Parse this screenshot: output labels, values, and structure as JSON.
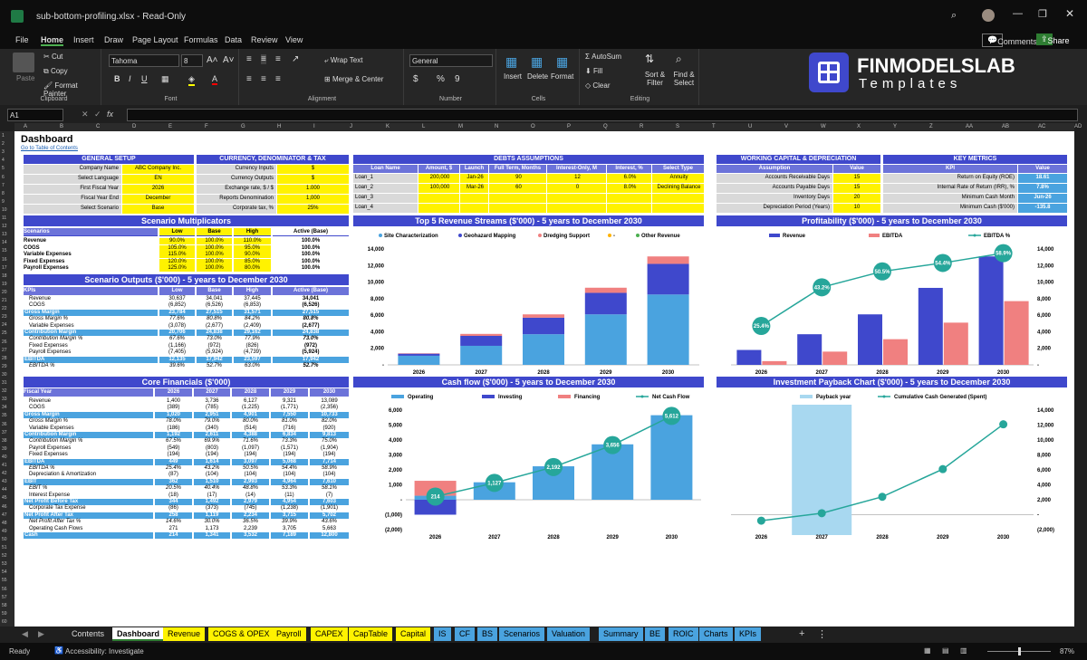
{
  "window": {
    "title": "sub-bottom-profiling.xlsx  -  Read-Only"
  },
  "menu": [
    "File",
    "Home",
    "Insert",
    "Draw",
    "Page Layout",
    "Formulas",
    "Data",
    "Review",
    "View"
  ],
  "ribbon": {
    "paste": "Paste",
    "cut": "Cut",
    "copy": "Copy",
    "format_painter": "Format Painter",
    "clipboard": "Clipboard",
    "font_name": "Tahoma",
    "font_size": "8",
    "font": "Font",
    "wrap": "Wrap Text",
    "merge": "Merge & Center",
    "alignment": "Alignment",
    "number_format": "General",
    "number": "Number",
    "insert": "Insert",
    "delete": "Delete",
    "format": "Format",
    "cells": "Cells",
    "autosum": "AutoSum",
    "fill": "Fill",
    "clear": "Clear",
    "sort": "Sort & Filter",
    "find": "Find & Select",
    "editing": "Editing",
    "comments": "Comments",
    "share": "Share",
    "brand": "FINMODELSLAB",
    "brand_sub": "Templates"
  },
  "formula": {
    "cell": "A1",
    "fx": "fx"
  },
  "columns": [
    "A",
    "B",
    "C",
    "D",
    "E",
    "F",
    "G",
    "H",
    "I",
    "J",
    "K",
    "L",
    "M",
    "N",
    "O",
    "P",
    "Q",
    "R",
    "S",
    "T",
    "U",
    "V",
    "W",
    "X",
    "Y",
    "Z",
    "AA",
    "AB",
    "AC",
    "AD"
  ],
  "dashboard": {
    "title": "Dashboard",
    "toc": "Go to Table of Contents"
  },
  "general": {
    "title": "GENERAL SETUP",
    "rows": [
      [
        "Company Name",
        "ABC Company Inc."
      ],
      [
        "Select Language",
        "EN"
      ],
      [
        "First Fiscal Year",
        "2026"
      ],
      [
        "Fiscal Year End",
        "December"
      ],
      [
        "Select Scenario",
        "Base"
      ]
    ]
  },
  "currency": {
    "title": "CURRENCY, DENOMINATOR & TAX",
    "rows": [
      [
        "Currency Inputs",
        "$"
      ],
      [
        "Currency Outputs",
        "$"
      ],
      [
        "Exchange rate, $ / $",
        "1.000"
      ],
      [
        "Reports Denomination",
        "1,000"
      ],
      [
        "Corporate tax, %",
        "25%"
      ]
    ]
  },
  "debts": {
    "title": "DEBTS ASSUMPTIONS",
    "headers": [
      "Loan Name",
      "Amount, $",
      "Launch",
      "Full Term, Months",
      "Interest-Only, M",
      "Interest, %",
      "Select Type"
    ],
    "rows": [
      [
        "Loan_1",
        "200,000",
        "Jan-26",
        "90",
        "12",
        "6.0%",
        "Annuity"
      ],
      [
        "Loan_2",
        "100,000",
        "Mar-26",
        "60",
        "0",
        "8.0%",
        "Declining Balance"
      ],
      [
        "Loan_3",
        "",
        "",
        "",
        "",
        "",
        ""
      ],
      [
        "Loan_4",
        "",
        "",
        "",
        "",
        "",
        ""
      ]
    ]
  },
  "wc": {
    "title": "WORKING CAPITAL & DEPRECIATION",
    "headers": [
      "Assumption",
      "Value"
    ],
    "rows": [
      [
        "Accounts Receivable Days",
        "15"
      ],
      [
        "Accounts Payable Days",
        "15"
      ],
      [
        "Inventory Days",
        "20"
      ],
      [
        "Depreciation Period (Years)",
        "10"
      ]
    ]
  },
  "kpi": {
    "title": "KEY METRICS",
    "headers": [
      "KPI",
      "Value"
    ],
    "rows": [
      [
        "Return on Equity (ROE)",
        "18.61"
      ],
      [
        "Internal Rate of Return (IRR), %",
        "7.8%"
      ],
      [
        "Minimum Cash Month",
        "Jun-26"
      ],
      [
        "Minimum Cash ($'000)",
        "-135.8"
      ]
    ]
  },
  "multipliers": {
    "title": "Scenario Multiplicators",
    "headers": [
      "Scenarios",
      "Low",
      "Base",
      "High",
      "Active (Base)"
    ],
    "rows": [
      [
        "Revenue",
        "90.0%",
        "100.0%",
        "110.0%",
        "100.0%"
      ],
      [
        "COGS",
        "105.0%",
        "100.0%",
        "95.0%",
        "100.0%"
      ],
      [
        "Variable Expenses",
        "115.0%",
        "100.0%",
        "90.0%",
        "100.0%"
      ],
      [
        "Fixed Expenses",
        "120.0%",
        "100.0%",
        "85.0%",
        "100.0%"
      ],
      [
        "Payroll Expenses",
        "125.0%",
        "100.0%",
        "80.0%",
        "100.0%"
      ]
    ]
  },
  "outputs": {
    "title": "Scenario Outputs ($'000) - 5 years to December 2030",
    "headers": [
      "KPIs",
      "Low",
      "Base",
      "High",
      "Active (Base)"
    ],
    "rows": [
      [
        "Revenue",
        "30,637",
        "34,041",
        "37,445",
        "34,041",
        ""
      ],
      [
        "COGS",
        "(6,852)",
        "(6,526)",
        "(6,853)",
        "(6,526)",
        ""
      ],
      [
        "Gross Margin",
        "23,784",
        "27,515",
        "31,571",
        "27,515",
        "b"
      ],
      [
        "Gross Margin %",
        "77.6%",
        "80.8%",
        "84.2%",
        "80.8%",
        "i"
      ],
      [
        "Variable Expenses",
        "(3,078)",
        "(2,677)",
        "(2,409)",
        "(2,677)",
        ""
      ],
      [
        "Contribution Margin",
        "20,706",
        "24,838",
        "29,162",
        "24,838",
        "b"
      ],
      [
        "Contribution Margin %",
        "67.6%",
        "73.0%",
        "77.9%",
        "73.0%",
        "i"
      ],
      [
        "Fixed Expenses",
        "(1,166)",
        "(972)",
        "(826)",
        "(972)",
        ""
      ],
      [
        "Payroll Expenses",
        "(7,405)",
        "(5,924)",
        "(4,739)",
        "(5,924)",
        ""
      ],
      [
        "EBITDA",
        "12,135",
        "17,942",
        "23,597",
        "17,942",
        "b"
      ],
      [
        "EBITDA %",
        "39.6%",
        "52.7%",
        "63.0%",
        "52.7%",
        "i"
      ]
    ]
  },
  "core": {
    "title": "Core Financials ($'000)",
    "headers": [
      "Fiscal Year",
      "2026",
      "2027",
      "2028",
      "2029",
      "2030"
    ],
    "rows": [
      [
        "Revenue",
        "1,400",
        "3,736",
        "6,127",
        "9,321",
        "13,089",
        ""
      ],
      [
        "COGS",
        "(389)",
        "(785)",
        "(1,225)",
        "(1,771)",
        "(2,356)",
        ""
      ],
      [
        "Gross Margin",
        "1,020",
        "2,951",
        "4,901",
        "7,550",
        "10,733",
        "b"
      ],
      [
        "Gross Margin %",
        "78.0%",
        "79.0%",
        "80.0%",
        "81.0%",
        "82.0%",
        "i"
      ],
      [
        "Variable Expenses",
        "(186)",
        "(340)",
        "(514)",
        "(716)",
        "(920)",
        ""
      ],
      [
        "Contribution Margin",
        "1,192",
        "2,611",
        "4,388",
        "6,834",
        "9,813",
        "b"
      ],
      [
        "Contribution Margin %",
        "67.5%",
        "69.9%",
        "71.6%",
        "73.3%",
        "75.0%",
        "i"
      ],
      [
        "Payroll Expenses",
        "(549)",
        "(803)",
        "(1,097)",
        "(1,571)",
        "(1,904)",
        ""
      ],
      [
        "Fixed Expenses",
        "(194)",
        "(194)",
        "(194)",
        "(194)",
        "(194)",
        ""
      ],
      [
        "EBITDA",
        "449",
        "1,614",
        "3,097",
        "5,068",
        "7,714",
        "b"
      ],
      [
        "EBITDA %",
        "25.4%",
        "43.2%",
        "50.5%",
        "54.4%",
        "58.9%",
        "i"
      ],
      [
        "Depreciation & Amortization",
        "(87)",
        "(104)",
        "(104)",
        "(104)",
        "(104)",
        ""
      ],
      [
        "EBIT",
        "362",
        "1,510",
        "2,993",
        "4,964",
        "7,610",
        "b"
      ],
      [
        "EBIT %",
        "20.5%",
        "40.4%",
        "48.8%",
        "53.3%",
        "58.1%",
        "i"
      ],
      [
        "Interest Expense",
        "(18)",
        "(17)",
        "(14)",
        "(11)",
        "(7)",
        ""
      ],
      [
        "Net Profit Before Tax",
        "344",
        "1,492",
        "2,979",
        "4,954",
        "7,603",
        "b"
      ],
      [
        "Corporate Tax Expense",
        "(86)",
        "(373)",
        "(745)",
        "(1,238)",
        "(1,901)",
        ""
      ],
      [
        "Net Profit After Tax",
        "258",
        "1,119",
        "2,234",
        "3,715",
        "5,702",
        "b"
      ],
      [
        "Net Profit After Tax %",
        "14.6%",
        "30.0%",
        "36.5%",
        "39.9%",
        "43.6%",
        "i"
      ],
      [
        "Operating Cash Flows",
        "271",
        "1,173",
        "2,239",
        "3,705",
        "5,663",
        ""
      ],
      [
        "Cash",
        "214",
        "1,341",
        "3,532",
        "7,189",
        "12,800",
        "b"
      ]
    ]
  },
  "chart_data": [
    {
      "type": "bar",
      "title": "Top 5 Revenue Streams ($'000) - 5 years to December 2030",
      "categories": [
        "2026",
        "2027",
        "2028",
        "2029",
        "2030"
      ],
      "series": [
        {
          "name": "Site Characterization",
          "values": [
            1100,
            2300,
            3700,
            6100,
            8500
          ]
        },
        {
          "name": "Geohazard Mapping",
          "values": [
            250,
            1200,
            2000,
            2600,
            3700
          ]
        },
        {
          "name": "Dredging Support",
          "values": [
            50,
            240,
            400,
            620,
            900
          ]
        },
        {
          "name": "-",
          "values": [
            0,
            0,
            0,
            0,
            0
          ]
        },
        {
          "name": "Other Revenue",
          "values": [
            0,
            0,
            0,
            0,
            0
          ]
        }
      ],
      "ylim": [
        0,
        14000
      ],
      "yticks": [
        "-",
        "2,000",
        "4,000",
        "6,000",
        "8,000",
        "10,000",
        "12,000",
        "14,000"
      ]
    },
    {
      "type": "bar",
      "title": "Profitability ($'000) - 5 years to December 2030",
      "categories": [
        "2026",
        "2027",
        "2028",
        "2029",
        "2030"
      ],
      "series": [
        {
          "name": "Revenue",
          "values": [
            1800,
            3700,
            6100,
            9300,
            13100
          ]
        },
        {
          "name": "EBITDA",
          "values": [
            450,
            1600,
            3100,
            5100,
            7700
          ]
        },
        {
          "name": "EBITDA %",
          "values": [
            25.4,
            43.2,
            50.5,
            54.4,
            58.9
          ]
        }
      ],
      "ylim": [
        0,
        14000
      ],
      "yticks": [
        "-",
        "2,000",
        "4,000",
        "6,000",
        "8,000",
        "10,000",
        "12,000",
        "14,000"
      ]
    },
    {
      "type": "bar",
      "title": "Cash flow ($'000) - 5 years to December 2030",
      "categories": [
        "2026",
        "2027",
        "2028",
        "2029",
        "2030"
      ],
      "series": [
        {
          "name": "Operating",
          "values": [
            270,
            1170,
            2240,
            3710,
            5660
          ]
        },
        {
          "name": "Investing",
          "values": [
            -1000,
            0,
            0,
            0,
            0
          ]
        },
        {
          "name": "Financing",
          "values": [
            1000,
            0,
            0,
            0,
            0
          ]
        },
        {
          "name": "Net Cash Flow",
          "values": [
            214,
            1127,
            2192,
            3656,
            5612
          ]
        }
      ],
      "ylim": [
        -2000,
        6000
      ],
      "yticks": [
        "(2,000)",
        "(1,000)",
        "-",
        "1,000",
        "2,000",
        "3,000",
        "4,000",
        "5,000",
        "6,000"
      ]
    },
    {
      "type": "line",
      "title": "Investment Payback Chart ($'000) - 5 years to December 2030",
      "categories": [
        "2026",
        "2027",
        "2028",
        "2029",
        "2030"
      ],
      "series": [
        {
          "name": "Payback year",
          "values": [
            0,
            1,
            0,
            0,
            0
          ]
        },
        {
          "name": "Cumulative Cash Generated (Spent)",
          "values": [
            -800,
            200,
            2400,
            6100,
            12100
          ]
        }
      ],
      "ylim": [
        -2000,
        14000
      ],
      "yticks": [
        "(2,000)",
        "-",
        "2,000",
        "4,000",
        "6,000",
        "8,000",
        "10,000",
        "12,000",
        "14,000"
      ]
    }
  ],
  "sheet_tabs": [
    "Contents",
    "Dashboard",
    "Revenue",
    "COGS & OPEX",
    "Payroll",
    "CAPEX",
    "CapTable",
    "Capital",
    "IS",
    "CF",
    "BS",
    "Scenarios",
    "Valuation",
    "Summary",
    "BE",
    "ROIC",
    "Charts",
    "KPIs"
  ],
  "status": {
    "ready": "Ready",
    "accessibility": "Accessibility: Investigate",
    "zoom": "87%"
  }
}
